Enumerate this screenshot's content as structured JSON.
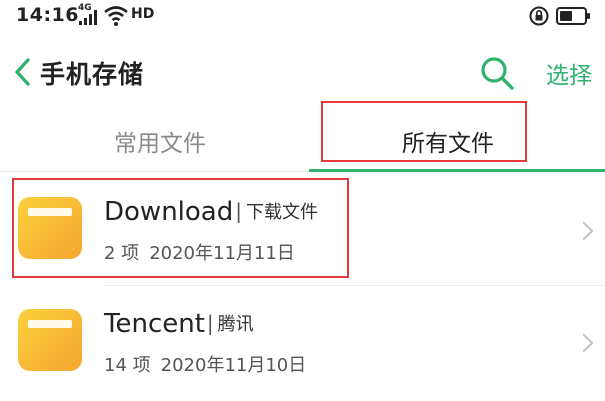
{
  "status_bar": {
    "time": "14:16",
    "signal_label": "4G",
    "hd_label": "HD"
  },
  "header": {
    "title": "手机存储",
    "select_label": "选择"
  },
  "tabs": [
    {
      "label": "常用文件",
      "active": false
    },
    {
      "label": "所有文件",
      "active": true
    }
  ],
  "colors": {
    "accent": "#2fb36e",
    "annotation": "#e33a3a",
    "folder": "#f7c134"
  },
  "folders": [
    {
      "name": "Download",
      "separator": "|",
      "description": "下载文件",
      "count": "2 项",
      "date": "2020年11月11日"
    },
    {
      "name": "Tencent",
      "separator": "|",
      "description": "腾讯",
      "count": "14 项",
      "date": "2020年11月10日"
    }
  ]
}
